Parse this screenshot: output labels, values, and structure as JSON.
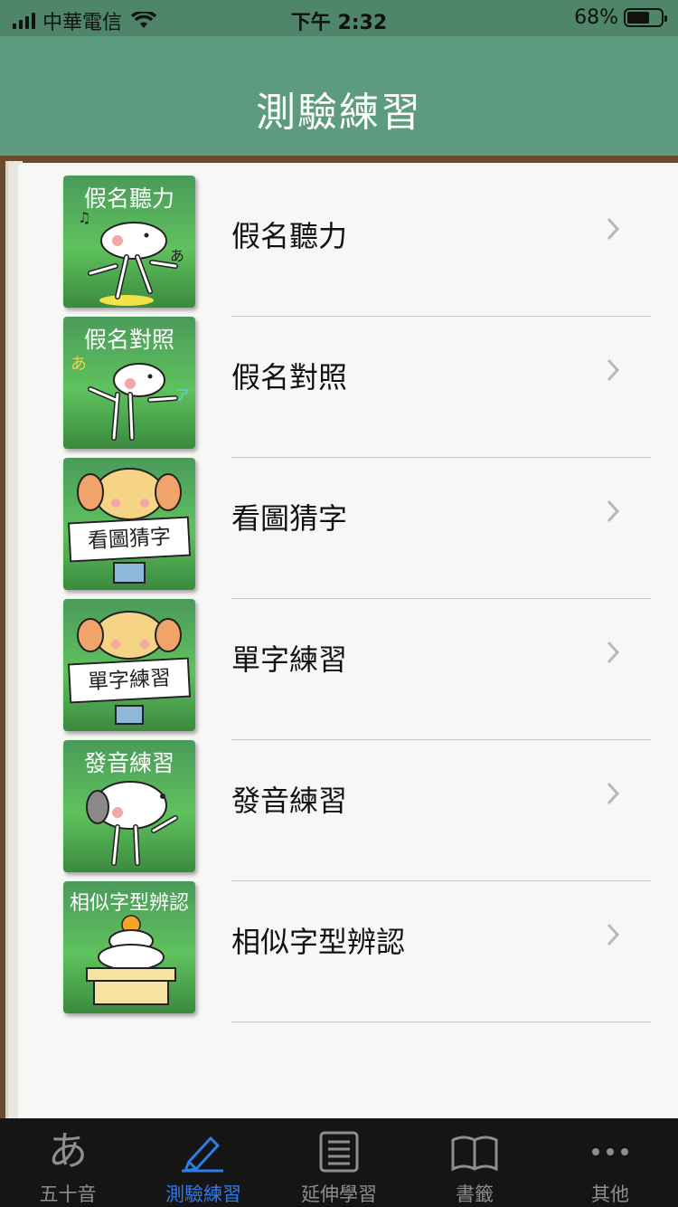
{
  "status_bar": {
    "carrier": "中華電信",
    "time": "下午 2:32",
    "battery": "68%",
    "battery_level": 0.68
  },
  "nav": {
    "title": "測驗練習"
  },
  "rows": [
    {
      "label": "假名聽力",
      "thumb_caption": "假名聽力",
      "thumb_sign": ""
    },
    {
      "label": "假名對照",
      "thumb_caption": "假名對照",
      "thumb_sign": ""
    },
    {
      "label": "看圖猜字",
      "thumb_caption": "",
      "thumb_sign": "看圖猜字"
    },
    {
      "label": "單字練習",
      "thumb_caption": "",
      "thumb_sign": "單字練習"
    },
    {
      "label": "發音練習",
      "thumb_caption": "發音練習",
      "thumb_sign": ""
    },
    {
      "label": "相似字型辨認",
      "thumb_caption": "相似字型辨認",
      "thumb_sign": ""
    }
  ],
  "tabs": [
    {
      "label": "五十音",
      "icon": "hiragana-a-icon",
      "glyph": "あ",
      "active": false
    },
    {
      "label": "測驗練習",
      "icon": "pencil-icon",
      "glyph": "",
      "active": true
    },
    {
      "label": "延伸學習",
      "icon": "document-list-icon",
      "glyph": "",
      "active": false
    },
    {
      "label": "書籤",
      "icon": "book-icon",
      "glyph": "",
      "active": false
    },
    {
      "label": "其他",
      "icon": "more-icon",
      "glyph": "",
      "active": false
    }
  ],
  "colors": {
    "active_tab": "#2f7be8",
    "header": "#5c9b7f",
    "thumb_green": "#5fc25d"
  }
}
